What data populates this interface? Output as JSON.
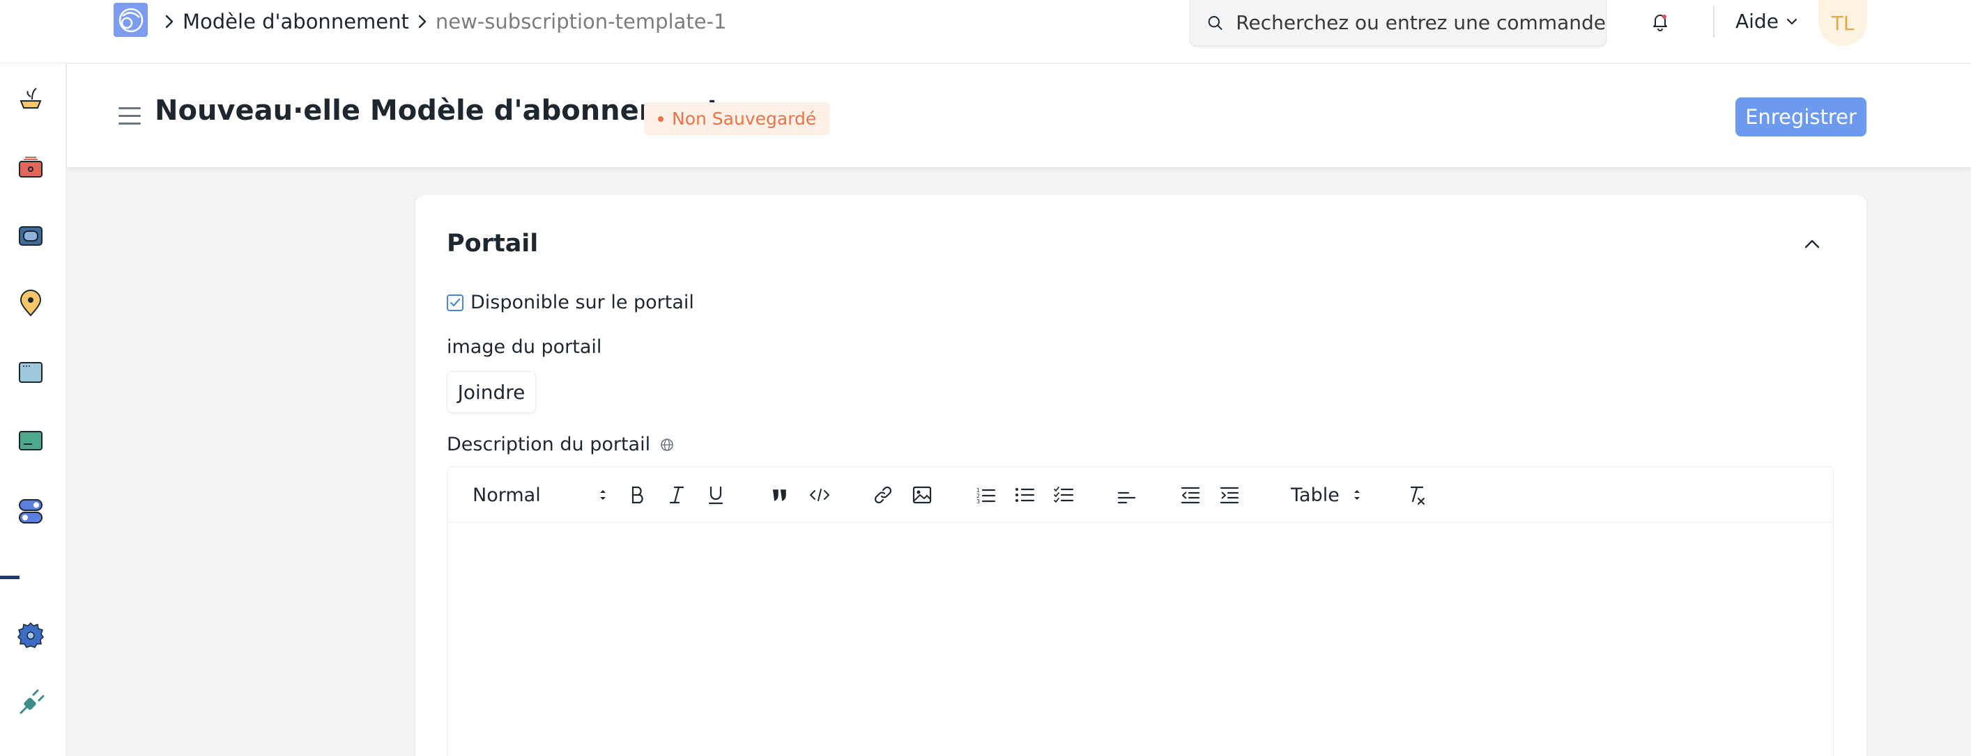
{
  "navbar": {
    "breadcrumb": {
      "parent": "Modèle d'abonnement",
      "current": "new-subscription-template-1"
    },
    "search_placeholder": "Recherchez ou entrez une commande",
    "help_label": "Aide",
    "avatar_initials": "TL",
    "logo_color": "#7b9cf0"
  },
  "page_header": {
    "title": "Nouveau·elle Modèle d'abonnement",
    "status_badge": "Non Sauvegardé",
    "save_label": "Enregistrer"
  },
  "section": {
    "title": "Portail",
    "portal_checkbox_label": "Disponible sur le portail",
    "portal_checkbox_checked": true,
    "portal_image_label": "image du portail",
    "attach_label": "Joindre",
    "portal_description_label": "Description du portail"
  },
  "editor_toolbar": {
    "heading_select": "Normal",
    "table_select": "Table"
  },
  "colors": {
    "primary_button": "#6b9aee",
    "badge_text": "#e8744a",
    "badge_bg": "#fdf0e7",
    "avatar_bg": "#fdf3e0",
    "avatar_text": "#e1a94b"
  },
  "sidebar_icons": [
    "bowl-icon",
    "toolbox-icon",
    "wallet-icon",
    "map-pin-icon",
    "window-icon",
    "card-icon",
    "toggle-icon",
    "gear-icon",
    "plug-icon"
  ]
}
